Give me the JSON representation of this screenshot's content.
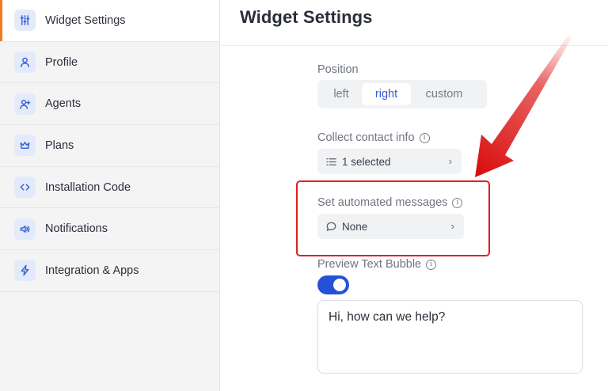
{
  "sidebar": {
    "items": [
      {
        "label": "Widget Settings",
        "icon": "sliders-icon",
        "active": true
      },
      {
        "label": "Profile",
        "icon": "user-icon"
      },
      {
        "label": "Agents",
        "icon": "user-plus-icon"
      },
      {
        "label": "Plans",
        "icon": "crown-icon"
      },
      {
        "label": "Installation Code",
        "icon": "code-icon"
      },
      {
        "label": "Notifications",
        "icon": "speaker-icon"
      },
      {
        "label": "Integration & Apps",
        "icon": "bolt-icon"
      }
    ]
  },
  "main": {
    "title": "Widget Settings",
    "position": {
      "label": "Position",
      "options": [
        "left",
        "right",
        "custom"
      ],
      "selected": "right"
    },
    "collect_contact": {
      "label": "Collect contact info",
      "value": "1 selected"
    },
    "automated_messages": {
      "label": "Set automated messages",
      "value": "None"
    },
    "preview_bubble": {
      "label": "Preview Text Bubble",
      "enabled": true,
      "text": "Hi, how can we help?"
    }
  },
  "colors": {
    "accent": "#2451d8",
    "active_indicator": "#f47b20",
    "annotation": "#e02020"
  }
}
